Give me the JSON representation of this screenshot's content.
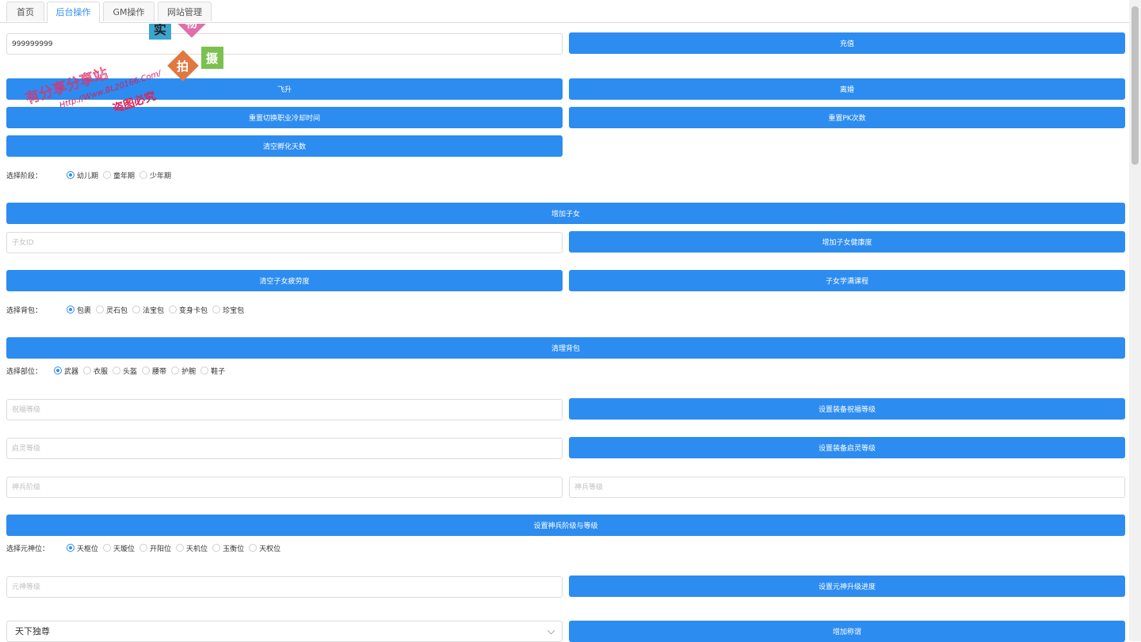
{
  "tabs": [
    "首页",
    "后台操作",
    "GM操作",
    "网站管理"
  ],
  "active_tab": "后台操作",
  "recharge": {
    "value": "999999999",
    "button": "充值"
  },
  "actions_1": {
    "feisheng": "飞升",
    "lihun": "离婚",
    "reset_job": "重置切换职业冷却时间",
    "reset_pk": "重置PK次数",
    "clear_hatch": "清空孵化天数"
  },
  "stage": {
    "label": "选择阶段：",
    "options": [
      "幼儿期",
      "童年期",
      "少年期"
    ],
    "selected": "幼儿期"
  },
  "child": {
    "add_button": "增加子女",
    "id_placeholder": "子女ID",
    "add_health_button": "增加子女健康度",
    "clear_fatigue_button": "清空子女疲劳度",
    "learn_all_button": "子女学满课程"
  },
  "bag": {
    "label": "选择背包：",
    "options": [
      "包裹",
      "灵石包",
      "法宝包",
      "变身卡包",
      "珍宝包"
    ],
    "selected": "包裹",
    "clear_button": "清理背包"
  },
  "part": {
    "label": "选择部位：",
    "options": [
      "武器",
      "衣服",
      "头盔",
      "腰带",
      "护腕",
      "鞋子"
    ],
    "selected": "武器"
  },
  "equip": {
    "bless_placeholder": "祝福等级",
    "bless_button": "设置装备祝福等级",
    "spirit_placeholder": "启灵等级",
    "spirit_button": "设置装备启灵等级",
    "divine_stage_placeholder": "神兵阶级",
    "divine_level_placeholder": "神兵等级",
    "divine_button": "设置神兵阶级与等级"
  },
  "yuanshen": {
    "label": "选择元神位：",
    "options": [
      "天枢位",
      "天璇位",
      "开阳位",
      "天机位",
      "玉衡位",
      "天权位"
    ],
    "selected": "天枢位",
    "level_placeholder": "元神等级",
    "button": "设置元神升级进度"
  },
  "title": {
    "selected": "天下独尊",
    "button": "增加称谓"
  },
  "watermark": {
    "line1": "有分享分享站",
    "line2": "Http://Www.BL20166.Com/",
    "line3": "盗图必究",
    "badge1": "实",
    "badge2": "物",
    "badge3": "拍",
    "badge4": "摄"
  },
  "colors": {
    "primary": "#2d8cf0",
    "border": "#dcdcdc"
  }
}
